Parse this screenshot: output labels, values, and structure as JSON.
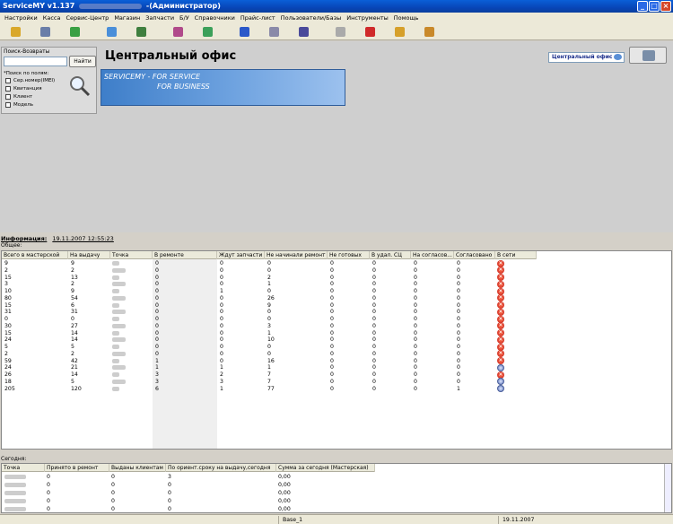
{
  "window": {
    "title_prefix": "ServiceMY v1.137",
    "title_suffix": "-(Администратор)"
  },
  "menu": [
    "Настройки",
    "Касса",
    "Сервис-Центр",
    "Магазин",
    "Запчасти",
    "Б/У",
    "Справочники",
    "Прайс-лист",
    "Пользователи/Базы",
    "Инструменты",
    "Помощь"
  ],
  "toolbar_icons": [
    "new-doc-icon",
    "tools-icon",
    "home-icon",
    "calendar-icon",
    "person-icon",
    "book-icon",
    "refresh-icon",
    "cart-icon",
    "gear-icon",
    "list-icon",
    "page-icon",
    "heart-icon",
    "alarm-icon",
    "report-icon"
  ],
  "search": {
    "label": "Поиск-Возвраты",
    "button": "Найти",
    "subtitle": "*Поиск по полям:",
    "options": [
      "Сер.номер(IMEI)",
      "Квитанция",
      "Клиент",
      "Модель"
    ]
  },
  "office": {
    "title": "Центральный офис",
    "selector": "Центральный офис"
  },
  "banner": {
    "line1": "SERVICEMY - FOR SERVICE",
    "line2": "FOR BUSINESS"
  },
  "info": {
    "label": "Информация:",
    "datetime": "19.11.2007 12:55:23"
  },
  "general_label": "Общее:",
  "main_table": {
    "columns": [
      "Всего в мастерской",
      "На выдачу",
      "Точка",
      "В ремонте",
      "Ждут запчасти",
      "Не начинали ремонт",
      "Не готовых",
      "В удал. СЦ",
      "На согласов...",
      "Согласовано",
      "В сети"
    ],
    "rows": [
      [
        "9",
        "9",
        "0",
        "0",
        "0",
        "0",
        "0",
        "0",
        "0",
        "x"
      ],
      [
        "2",
        "2",
        "0",
        "0",
        "0",
        "0",
        "0",
        "0",
        "0",
        "x"
      ],
      [
        "15",
        "13",
        "0",
        "0",
        "2",
        "0",
        "0",
        "0",
        "0",
        "x"
      ],
      [
        "3",
        "2",
        "0",
        "0",
        "1",
        "0",
        "0",
        "0",
        "0",
        "x"
      ],
      [
        "10",
        "9",
        "0",
        "1",
        "0",
        "0",
        "0",
        "0",
        "0",
        "x"
      ],
      [
        "80",
        "54",
        "0",
        "0",
        "26",
        "0",
        "0",
        "0",
        "0",
        "x"
      ],
      [
        "15",
        "6",
        "0",
        "0",
        "9",
        "0",
        "0",
        "0",
        "0",
        "x"
      ],
      [
        "31",
        "31",
        "0",
        "0",
        "0",
        "0",
        "0",
        "0",
        "0",
        "x"
      ],
      [
        "0",
        "0",
        "0",
        "0",
        "0",
        "0",
        "0",
        "0",
        "0",
        "x"
      ],
      [
        "30",
        "27",
        "0",
        "0",
        "3",
        "0",
        "0",
        "0",
        "0",
        "x"
      ],
      [
        "15",
        "14",
        "0",
        "0",
        "1",
        "0",
        "0",
        "0",
        "0",
        "x"
      ],
      [
        "24",
        "14",
        "0",
        "0",
        "10",
        "0",
        "0",
        "0",
        "0",
        "x"
      ],
      [
        "5",
        "5",
        "0",
        "0",
        "0",
        "0",
        "0",
        "0",
        "0",
        "x"
      ],
      [
        "2",
        "2",
        "0",
        "0",
        "0",
        "0",
        "0",
        "0",
        "0",
        "x"
      ],
      [
        "59",
        "42",
        "1",
        "0",
        "16",
        "0",
        "0",
        "0",
        "0",
        "x"
      ],
      [
        "24",
        "21",
        "1",
        "1",
        "1",
        "0",
        "0",
        "0",
        "0",
        "ok"
      ],
      [
        "26",
        "14",
        "3",
        "2",
        "7",
        "0",
        "0",
        "0",
        "0",
        "x"
      ],
      [
        "18",
        "5",
        "3",
        "3",
        "7",
        "0",
        "0",
        "0",
        "0",
        "ok"
      ],
      [
        "205",
        "120",
        "6",
        "1",
        "77",
        "0",
        "0",
        "0",
        "1",
        "ok"
      ]
    ]
  },
  "today_label": "Сегодня:",
  "today_table": {
    "columns": [
      "Точка",
      "Принято в ремонт",
      "Выданы клиентам",
      "По ориент.сроку на выдачу,сегодня",
      "Сумма за сегодня  (Мастерская)"
    ],
    "rows": [
      [
        "0",
        "0",
        "3",
        "0,00"
      ],
      [
        "0",
        "0",
        "0",
        "0,00"
      ],
      [
        "0",
        "0",
        "0",
        "0,00"
      ],
      [
        "0",
        "0",
        "0",
        "0,00"
      ],
      [
        "0",
        "0",
        "0",
        "0,00"
      ]
    ]
  },
  "status": {
    "base": "Base_1",
    "date": "19.11.2007"
  }
}
